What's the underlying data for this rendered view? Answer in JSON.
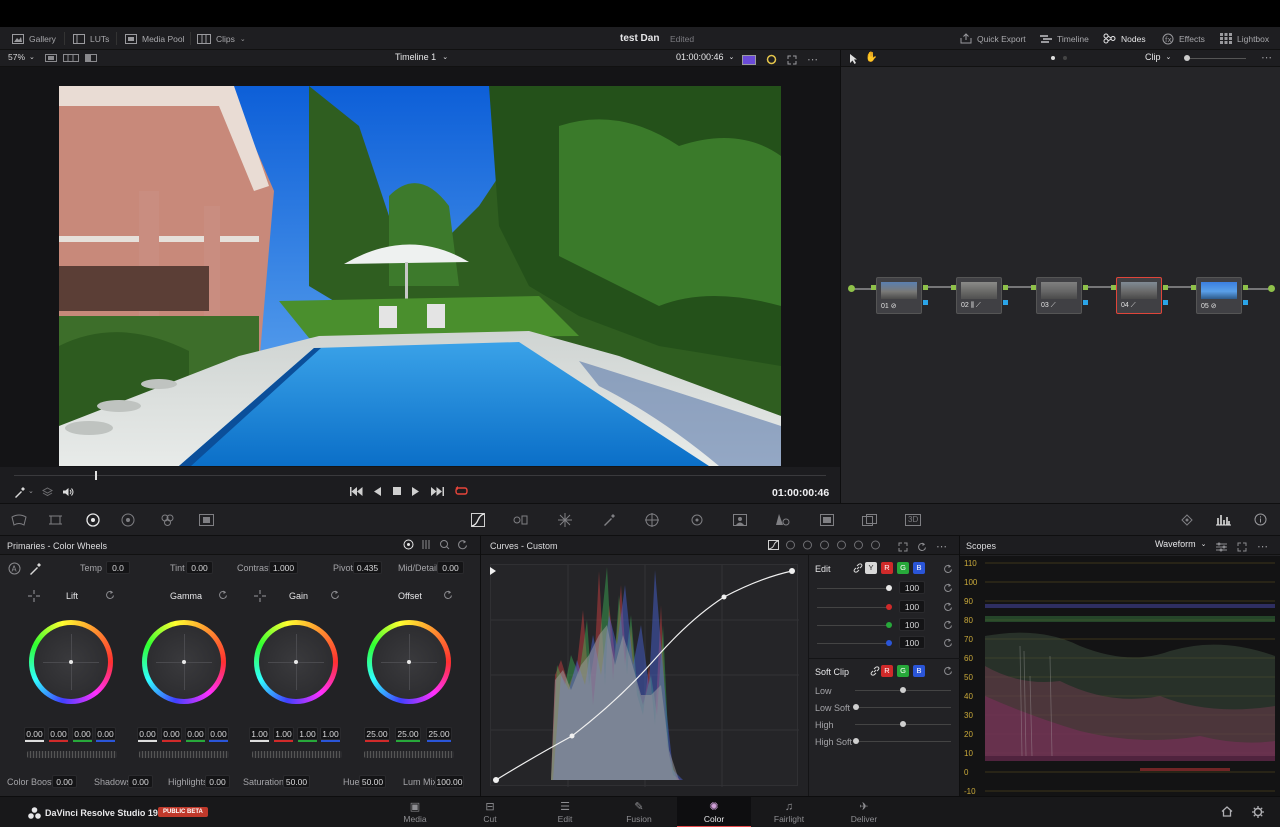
{
  "menubar": {
    "gallery": "Gallery",
    "luts": "LUTs",
    "media_pool": "Media Pool",
    "clips": "Clips",
    "project_title": "test Dan",
    "project_status": "Edited",
    "quick_export": "Quick Export",
    "timeline": "Timeline",
    "nodes": "Nodes",
    "effects": "Effects",
    "lightbox": "Lightbox"
  },
  "viewer": {
    "zoom": "57%",
    "timeline_name": "Timeline 1",
    "timecode_top": "01:00:00:46",
    "timecode": "01:00:00:46",
    "playhead_fraction": 0.1
  },
  "nodes": {
    "mode": "Clip",
    "items": [
      {
        "label": "01"
      },
      {
        "label": "02"
      },
      {
        "label": "03"
      },
      {
        "label": "04"
      },
      {
        "label": "05"
      }
    ]
  },
  "primaries": {
    "title": "Primaries - Color Wheels",
    "temp_label": "Temp",
    "temp": "0.0",
    "tint_label": "Tint",
    "tint": "0.00",
    "contrast_label": "Contrast",
    "contrast": "1.000",
    "pivot_label": "Pivot",
    "pivot": "0.435",
    "middetail_label": "Mid/Detail",
    "middetail": "0.00",
    "wheels": [
      {
        "name": "Lift",
        "values": [
          "0.00",
          "0.00",
          "0.00",
          "0.00"
        ]
      },
      {
        "name": "Gamma",
        "values": [
          "0.00",
          "0.00",
          "0.00",
          "0.00"
        ]
      },
      {
        "name": "Gain",
        "values": [
          "1.00",
          "1.00",
          "1.00",
          "1.00"
        ]
      },
      {
        "name": "Offset",
        "values": [
          "25.00",
          "25.00",
          "25.00"
        ]
      }
    ],
    "colorboost_label": "Color Boost",
    "colorboost": "0.00",
    "shadows_label": "Shadows",
    "shadows": "0.00",
    "highlights_label": "Highlights",
    "highlights": "0.00",
    "saturation_label": "Saturation",
    "saturation": "50.00",
    "hue_label": "Hue",
    "hue": "50.00",
    "lummix_label": "Lum Mix",
    "lummix": "100.00"
  },
  "curves": {
    "title": "Curves - Custom",
    "edit_label": "Edit",
    "channels": [
      "Y",
      "R",
      "G",
      "B"
    ],
    "intensities": [
      "100",
      "100",
      "100",
      "100"
    ],
    "softclip_label": "Soft Clip",
    "softclip_channels": [
      "R",
      "G",
      "B"
    ],
    "low_label": "Low",
    "lowsoft_label": "Low Soft",
    "high_label": "High",
    "highsoft_label": "High Soft"
  },
  "scopes": {
    "title": "Scopes",
    "mode": "Waveform",
    "ticks": [
      "110",
      "100",
      "90",
      "80",
      "70",
      "60",
      "50",
      "40",
      "30",
      "20",
      "10",
      "0",
      "-10"
    ]
  },
  "pagebar": {
    "app_name": "DaVinci Resolve Studio 19",
    "beta": "PUBLIC BETA",
    "pages": [
      "Media",
      "Cut",
      "Edit",
      "Fusion",
      "Color",
      "Fairlight",
      "Deliver"
    ],
    "active": "Color"
  },
  "colors": {
    "accent_red": "#e64b4b",
    "channel_red": "#d02a2a",
    "channel_green": "#27a83a",
    "channel_blue": "#2a55d8"
  }
}
